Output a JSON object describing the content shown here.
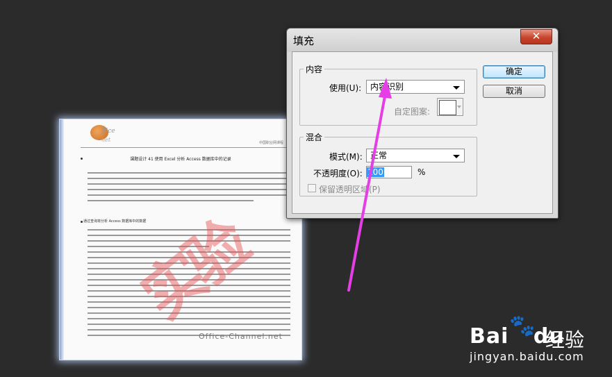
{
  "document": {
    "logo_text": "ffice",
    "logo_text2": "net",
    "header_right": "中国职业网课程",
    "title": "课题设计 41 使用 Excel 分析 Access 数据库中的记录",
    "section_heading": "通过查询将分析 Access 数据库中的数据",
    "watermark_text": "Office-Channel.net"
  },
  "dialog": {
    "title": "填充",
    "close_glyph": "✕",
    "content_group": {
      "legend": "内容",
      "use_label": "使用(U):",
      "use_value": "内容识别",
      "custom_pattern_label": "自定图案:"
    },
    "blend_group": {
      "legend": "混合",
      "mode_label": "模式(M):",
      "mode_value": "正常",
      "opacity_label": "不透明度(O):",
      "opacity_value": "100",
      "opacity_unit": "%",
      "preserve_label": "保留透明区域(P)"
    },
    "ok_label": "确定",
    "cancel_label": "取消"
  },
  "overlay": {
    "arrow_color": "#e63ee6",
    "baidu_logo": "Bai",
    "baidu_logo_tail": "du",
    "baidu_paw": "🐾",
    "baidu_jingyan": "经验",
    "baidu_url": "jingyan.baidu.com"
  }
}
